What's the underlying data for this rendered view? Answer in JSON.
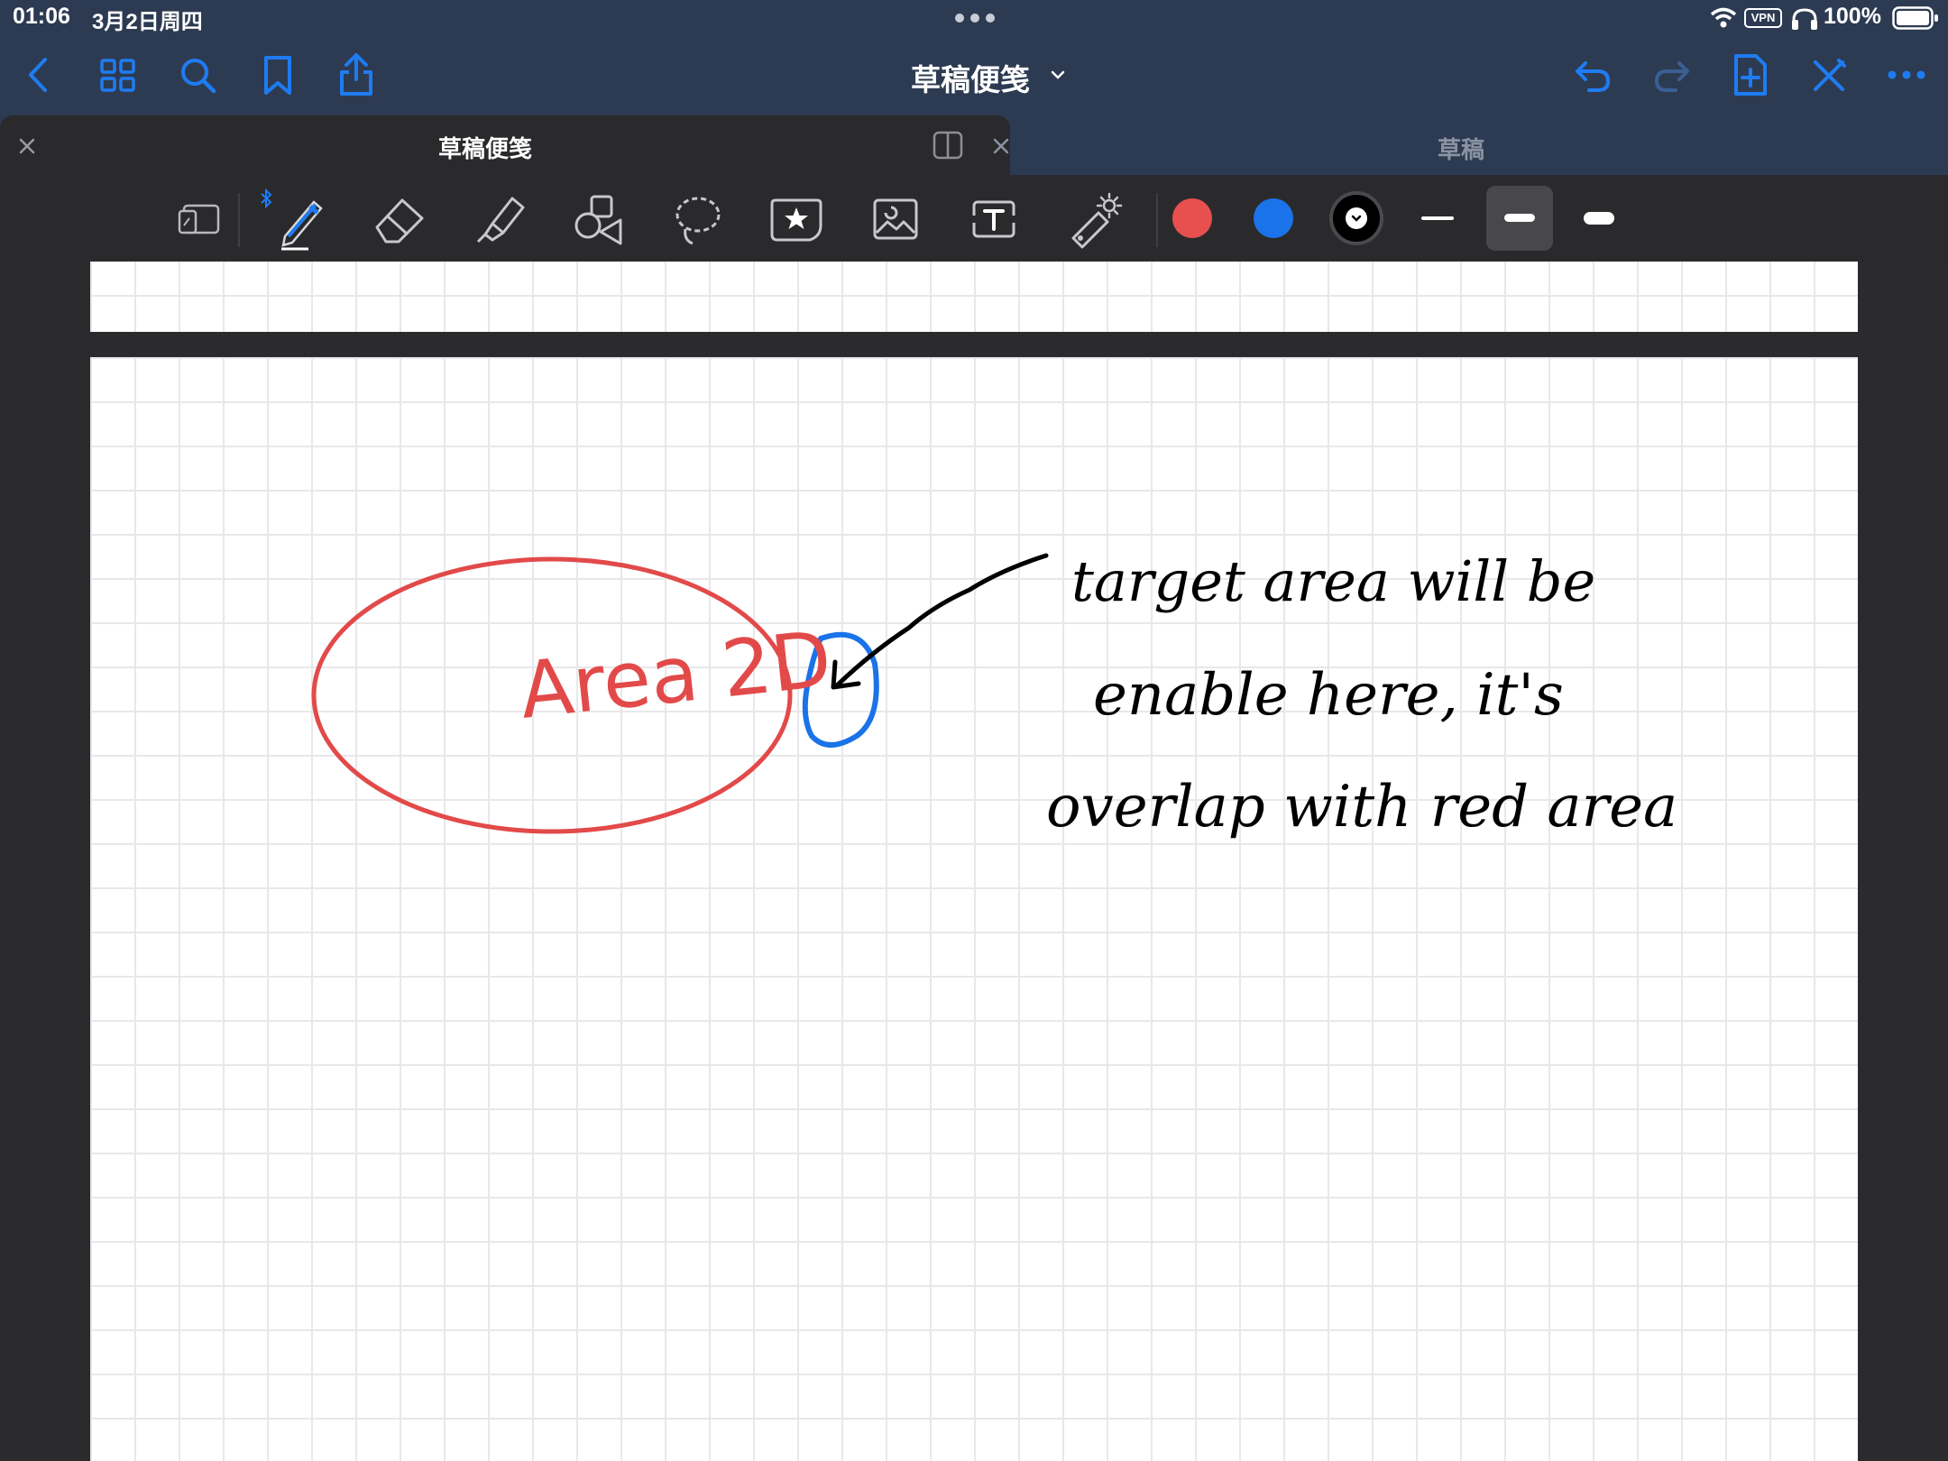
{
  "status": {
    "time": "01:06",
    "date": "3月2日周四",
    "vpn": "VPN",
    "battery": "100%"
  },
  "nav": {
    "title": "草稿便笺"
  },
  "tabs": [
    {
      "label": "草稿便笺"
    },
    {
      "label": "草稿"
    }
  ],
  "colors": {
    "accent": "#1e7cf2",
    "red_ink": "#e24a4a",
    "blue_ink": "#1a73e8",
    "black_ink": "#000000",
    "chrome": "#2d3b52",
    "toolbar": "#2a2a2c"
  },
  "toolbar": {
    "tools": [
      "keyboard-scribble-icon",
      "pen-icon",
      "eraser-icon",
      "highlighter-icon",
      "shapes-icon",
      "lasso-icon",
      "sticker-icon",
      "image-icon",
      "text-icon",
      "laser-pointer-icon"
    ],
    "swatches": [
      "#e85050",
      "#1a73e8",
      "#000000"
    ],
    "selected_stroke": "medium"
  },
  "note": {
    "red_label": "Area 2D",
    "black_line_1": "target area will be",
    "black_line_2": "enable here, it's",
    "black_line_3": "overlap with red area"
  }
}
